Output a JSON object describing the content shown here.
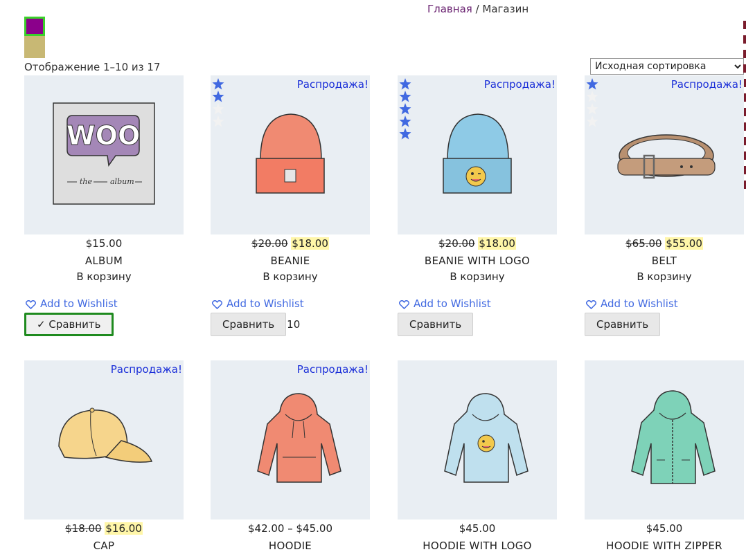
{
  "breadcrumb": {
    "home": "Главная",
    "separator": " / ",
    "current": "Магазин"
  },
  "result_count": "Отображение 1–10 из 17",
  "sort": {
    "selected": "Исходная сортировка"
  },
  "colors": {
    "sale_badge": "#1a2ed8",
    "wishlist": "#4169e1",
    "compare_active_border": "#1e8a1e",
    "swatch_purple": "#8b008b",
    "swatch_tan": "#c8b874"
  },
  "wishlist_label": "Add to Wishlist",
  "cart_label": "В корзину",
  "sale_label": "Распродажа!",
  "compare_label": "Сравнить",
  "products": [
    {
      "name": "ALBUM",
      "price": "$15.00",
      "icon": "album-art"
    },
    {
      "name": "BEANIE",
      "old_price": "$20.00",
      "price": "$18.00",
      "sale": "Распродажа!",
      "stars": 2,
      "icon": "beanie-art",
      "compare_count": "10"
    },
    {
      "name": "BEANIE WITH LOGO",
      "old_price": "$20.00",
      "price": "$18.00",
      "sale": "Распродажа!",
      "stars": 5,
      "icon": "beanie-logo-art"
    },
    {
      "name": "BELT",
      "old_price": "$65.00",
      "price": "$55.00",
      "sale": "Распродажа!",
      "stars": 1,
      "icon": "belt-art"
    },
    {
      "name": "CAP",
      "old_price": "$18.00",
      "price": "$16.00",
      "sale": "Распродажа!",
      "icon": "cap-art"
    },
    {
      "name": "HOODIE",
      "price": "$42.00 – $45.00",
      "sale": "Распродажа!",
      "icon": "hoodie-art"
    },
    {
      "name": "HOODIE WITH LOGO",
      "price": "$45.00",
      "icon": "hoodie-logo-art"
    },
    {
      "name": "HOODIE WITH ZIPPER",
      "price": "$45.00",
      "icon": "hoodie-zipper-art"
    }
  ],
  "compare_first": "✓ Сравнить"
}
